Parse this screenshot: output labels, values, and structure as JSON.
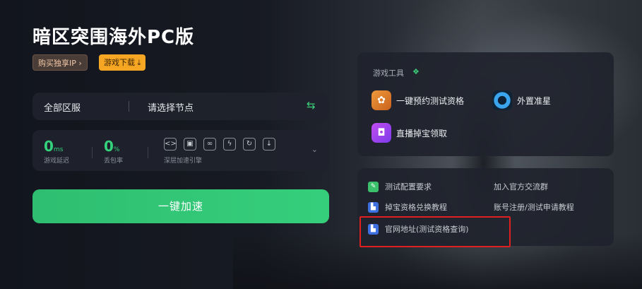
{
  "app": {
    "title": "暗区突围海外PC版",
    "buy_ip": "购买独享IP",
    "buy_ip_arrow": "›",
    "download": "游戏下载",
    "download_icon": "⤓"
  },
  "region": {
    "server": "全部区服",
    "node": "请选择节点",
    "swap_icon": "⇆"
  },
  "stats": {
    "latency_value": "0",
    "latency_unit": "ms",
    "latency_label": "游戏延迟",
    "loss_value": "0",
    "loss_unit": "%",
    "loss_label": "丢包率",
    "engine_label": "深层加速引擎",
    "tool_icons": [
      "<>",
      "▣",
      "∞",
      "ϟ",
      "↻",
      "↓"
    ],
    "expand_icon": "⌄"
  },
  "accelerate": {
    "label": "一键加速"
  },
  "game_tools": {
    "title": "游戏工具",
    "items": [
      {
        "label": "一键预约测试资格",
        "icon": "reserve-icon",
        "glyph": "✿"
      },
      {
        "label": "外置准星",
        "icon": "crosshair-icon",
        "glyph": ""
      },
      {
        "label": "直播掉宝领取",
        "icon": "live-drop-icon",
        "glyph": "◘"
      }
    ]
  },
  "links": {
    "items": [
      {
        "label": "测试配置要求",
        "icon": "edit-icon",
        "glyph": "✎"
      },
      {
        "label": "加入官方交流群",
        "icon": "",
        "glyph": ""
      },
      {
        "label": "掉宝资格兑换教程",
        "icon": "tutorial-icon",
        "glyph": "▙"
      },
      {
        "label": "账号注册/测试申请教程",
        "icon": "",
        "glyph": ""
      },
      {
        "label": "官网地址(测试资格查询)",
        "icon": "website-icon",
        "glyph": "▙"
      }
    ]
  },
  "colors": {
    "accent_green": "#34d27d",
    "download_orange": "#f5a623",
    "highlight_red": "#e02020"
  }
}
